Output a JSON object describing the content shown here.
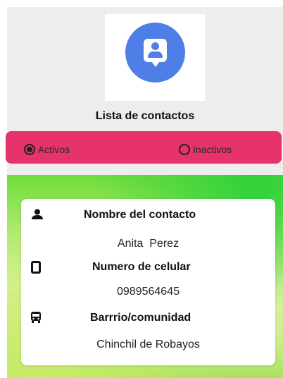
{
  "header": {
    "logo_icon": "contact-card-icon",
    "title": "Lista de contactos"
  },
  "filter": {
    "options": [
      {
        "label": "Activos",
        "selected": true
      },
      {
        "label": "Inactivos",
        "selected": false
      }
    ],
    "bar_color": "#e6336b"
  },
  "contact": {
    "name_label": "Nombre del contacto",
    "name_value": "Anita  Perez",
    "phone_label": "Numero de celular",
    "phone_value": "0989564645",
    "area_label": "Barrrio/comunidad",
    "area_value": "Chinchil de Robayos",
    "icons": [
      "person-icon",
      "phone-icon",
      "bus-icon"
    ]
  },
  "colors": {
    "accent_blue": "#4f7fe6",
    "background_green": "#6fdc3a"
  }
}
